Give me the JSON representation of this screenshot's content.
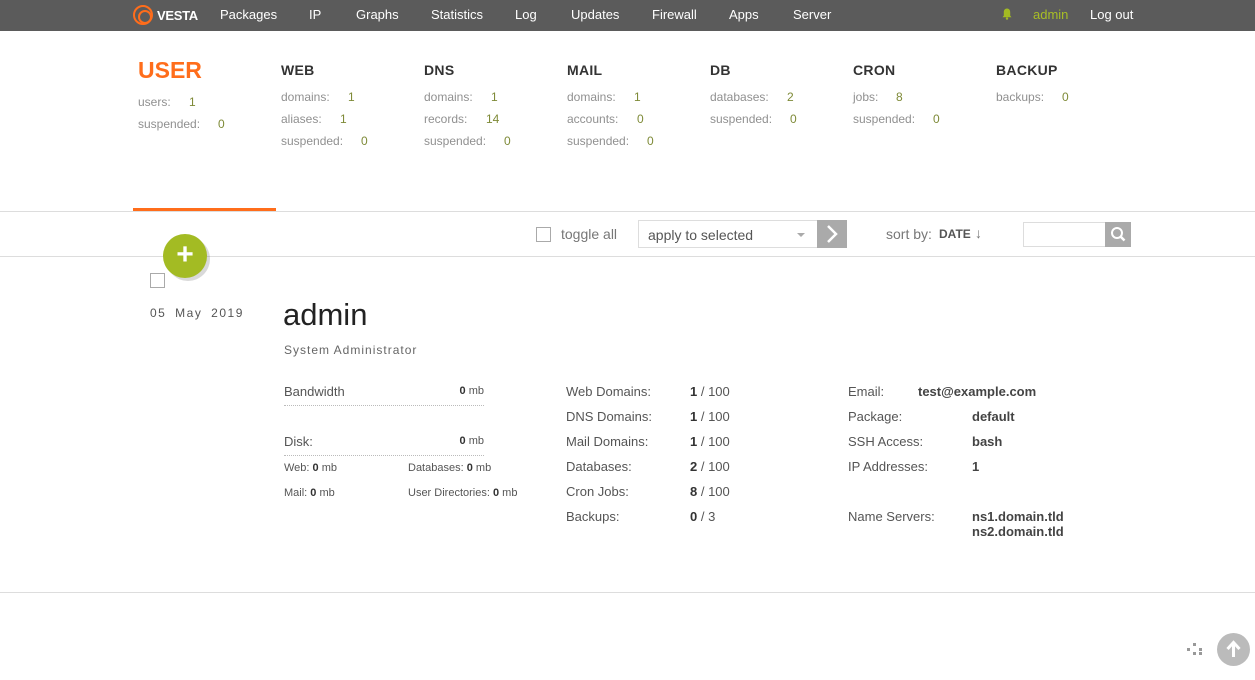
{
  "app": {
    "logo_text": "VESTA"
  },
  "topnav": {
    "items": [
      "Packages",
      "IP",
      "Graphs",
      "Statistics",
      "Log",
      "Updates",
      "Firewall",
      "Apps",
      "Server"
    ],
    "user": "admin",
    "logout": "Log out"
  },
  "stats": {
    "user": {
      "title": "USER",
      "rows": [
        {
          "label": "users:",
          "value": "1"
        },
        {
          "label": "suspended:",
          "value": "0"
        }
      ]
    },
    "web": {
      "title": "WEB",
      "rows": [
        {
          "label": "domains:",
          "value": "1"
        },
        {
          "label": "aliases:",
          "value": "1"
        },
        {
          "label": "suspended:",
          "value": "0"
        }
      ]
    },
    "dns": {
      "title": "DNS",
      "rows": [
        {
          "label": "domains:",
          "value": "1"
        },
        {
          "label": "records:",
          "value": "14"
        },
        {
          "label": "suspended:",
          "value": "0"
        }
      ]
    },
    "mail": {
      "title": "MAIL",
      "rows": [
        {
          "label": "domains:",
          "value": "1"
        },
        {
          "label": "accounts:",
          "value": "0"
        },
        {
          "label": "suspended:",
          "value": "0"
        }
      ]
    },
    "db": {
      "title": "DB",
      "rows": [
        {
          "label": "databases:",
          "value": "2"
        },
        {
          "label": "suspended:",
          "value": "0"
        }
      ]
    },
    "cron": {
      "title": "CRON",
      "rows": [
        {
          "label": "jobs:",
          "value": "8"
        },
        {
          "label": "suspended:",
          "value": "0"
        }
      ]
    },
    "backup": {
      "title": "BACKUP",
      "rows": [
        {
          "label": "backups:",
          "value": "0"
        }
      ]
    }
  },
  "toolbar": {
    "toggle_all": "toggle all",
    "apply_select": "apply to selected",
    "sort_label": "sort by:",
    "sort_value": "DATE",
    "sort_arrow": "↓",
    "add_symbol": "+"
  },
  "user_entry": {
    "date": "05 May 2019",
    "name": "admin",
    "role": "System Administrator",
    "bandwidth_label": "Bandwidth",
    "bandwidth_value": "0",
    "disk_label": "Disk:",
    "disk_value": "0",
    "unit": "mb",
    "web_label": "Web:",
    "web_value": "0",
    "databases_label": "Databases:",
    "databases_value": "0",
    "mail_label": "Mail:",
    "mail_value": "0",
    "userdirs_label": "User Directories:",
    "userdirs_value": "0",
    "limits": [
      {
        "label": "Web Domains:",
        "used": "1",
        "max": "100"
      },
      {
        "label": "DNS Domains:",
        "used": "1",
        "max": "100"
      },
      {
        "label": "Mail Domains:",
        "used": "1",
        "max": "100"
      },
      {
        "label": "Databases:",
        "used": "2",
        "max": "100"
      },
      {
        "label": "Cron Jobs:",
        "used": "8",
        "max": "100"
      },
      {
        "label": "Backups:",
        "used": "0",
        "max": "3"
      }
    ],
    "email_label": "Email:",
    "email": "test@example.com",
    "package_label": "Package:",
    "package": "default",
    "ssh_label": "SSH Access:",
    "ssh": "bash",
    "ip_label": "IP Addresses:",
    "ip": "1",
    "ns_label": "Name Servers:",
    "ns1": "ns1.domain.tld",
    "ns2": "ns2.domain.tld"
  },
  "colors": {
    "accent": "#ff6d1b",
    "green": "#a3bb23",
    "topbar": "#5b5b5b"
  }
}
